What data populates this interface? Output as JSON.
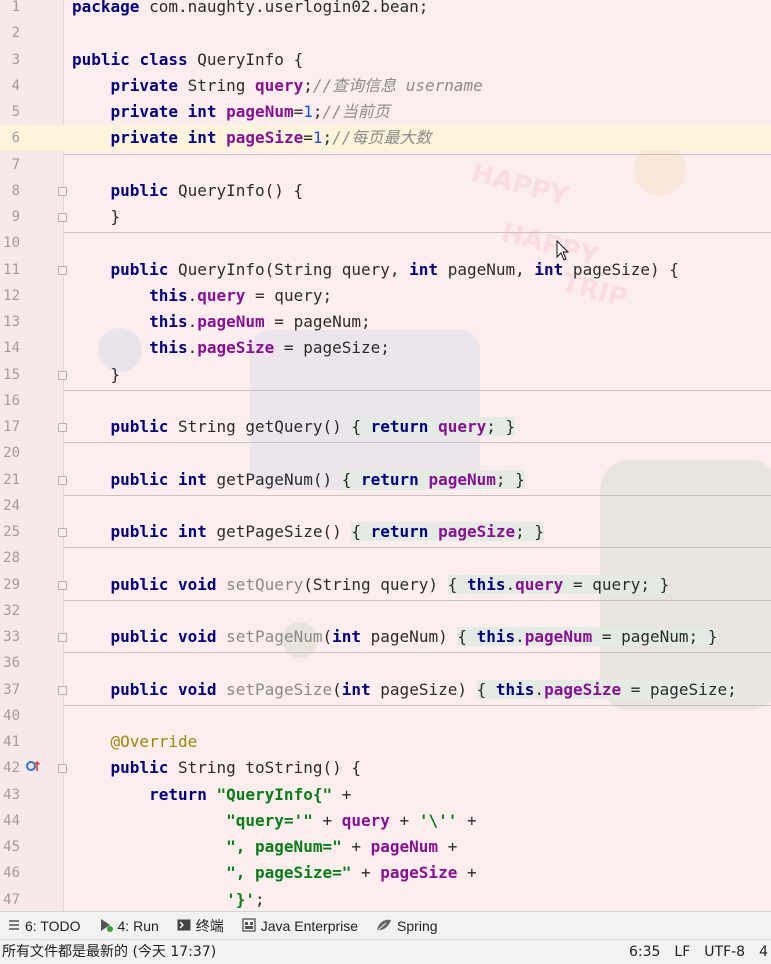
{
  "editor": {
    "lines": [
      {
        "n": "1",
        "tokens": [
          {
            "t": "package",
            "c": "kw"
          },
          {
            "t": " com.naughty.userlogin02.bean;"
          }
        ]
      },
      {
        "n": "2",
        "tokens": []
      },
      {
        "n": "3",
        "tokens": [
          {
            "t": "public",
            "c": "kw"
          },
          {
            "t": " "
          },
          {
            "t": "class",
            "c": "kw"
          },
          {
            "t": " QueryInfo {"
          }
        ]
      },
      {
        "n": "4",
        "tokens": [
          {
            "t": "    "
          },
          {
            "t": "private",
            "c": "kw"
          },
          {
            "t": " String "
          },
          {
            "t": "query",
            "c": "field"
          },
          {
            "t": ";"
          },
          {
            "t": "//查询信息 username",
            "c": "cmt"
          }
        ]
      },
      {
        "n": "5",
        "tokens": [
          {
            "t": "    "
          },
          {
            "t": "private",
            "c": "kw"
          },
          {
            "t": " "
          },
          {
            "t": "int",
            "c": "kw"
          },
          {
            "t": " "
          },
          {
            "t": "pageNum",
            "c": "field"
          },
          {
            "t": "="
          },
          {
            "t": "1",
            "c": "num"
          },
          {
            "t": ";"
          },
          {
            "t": "//当前页",
            "c": "cmt"
          }
        ]
      },
      {
        "n": "6",
        "current": true,
        "tokens": [
          {
            "t": "    "
          },
          {
            "t": "private",
            "c": "kw"
          },
          {
            "t": " "
          },
          {
            "t": "int",
            "c": "kw"
          },
          {
            "t": " "
          },
          {
            "t": "pageSize",
            "c": "field"
          },
          {
            "t": "="
          },
          {
            "t": "1",
            "c": "num"
          },
          {
            "t": ";"
          },
          {
            "t": "//每页最大数",
            "c": "cmt"
          }
        ]
      },
      {
        "n": "7",
        "tokens": [],
        "sep": true
      },
      {
        "n": "8",
        "fold": true,
        "tokens": [
          {
            "t": "    "
          },
          {
            "t": "public",
            "c": "kw"
          },
          {
            "t": " QueryInfo() {"
          }
        ]
      },
      {
        "n": "9",
        "fold": true,
        "tokens": [
          {
            "t": "    }"
          }
        ]
      },
      {
        "n": "10",
        "tokens": [],
        "sep": true
      },
      {
        "n": "11",
        "fold": true,
        "tokens": [
          {
            "t": "    "
          },
          {
            "t": "public",
            "c": "kw"
          },
          {
            "t": " QueryInfo(String query, "
          },
          {
            "t": "int",
            "c": "kw"
          },
          {
            "t": " pageNum, "
          },
          {
            "t": "int",
            "c": "kw"
          },
          {
            "t": " pageSize) {"
          }
        ]
      },
      {
        "n": "12",
        "tokens": [
          {
            "t": "        "
          },
          {
            "t": "this",
            "c": "kw"
          },
          {
            "t": "."
          },
          {
            "t": "query",
            "c": "field"
          },
          {
            "t": " = query;"
          }
        ]
      },
      {
        "n": "13",
        "tokens": [
          {
            "t": "        "
          },
          {
            "t": "this",
            "c": "kw"
          },
          {
            "t": "."
          },
          {
            "t": "pageNum",
            "c": "field"
          },
          {
            "t": " = pageNum;"
          }
        ]
      },
      {
        "n": "14",
        "tokens": [
          {
            "t": "        "
          },
          {
            "t": "this",
            "c": "kw"
          },
          {
            "t": "."
          },
          {
            "t": "pageSize",
            "c": "field"
          },
          {
            "t": " = pageSize;"
          }
        ]
      },
      {
        "n": "15",
        "fold": true,
        "tokens": [
          {
            "t": "    }"
          }
        ]
      },
      {
        "n": "16",
        "tokens": [],
        "sep": true
      },
      {
        "n": "17",
        "fold": true,
        "tokens": [
          {
            "t": "    "
          },
          {
            "t": "public",
            "c": "kw"
          },
          {
            "t": " String getQuery() "
          },
          {
            "t": "{ ",
            "c": "fold"
          },
          {
            "t": "return",
            "c": "kw fold"
          },
          {
            "t": " ",
            "c": "fold"
          },
          {
            "t": "query",
            "c": "field fold"
          },
          {
            "t": "; }",
            "c": "fold"
          }
        ]
      },
      {
        "n": "20",
        "tokens": [],
        "sep": true
      },
      {
        "n": "21",
        "fold": true,
        "tokens": [
          {
            "t": "    "
          },
          {
            "t": "public",
            "c": "kw"
          },
          {
            "t": " "
          },
          {
            "t": "int",
            "c": "kw"
          },
          {
            "t": " getPageNum() "
          },
          {
            "t": "{ ",
            "c": "fold"
          },
          {
            "t": "return",
            "c": "kw fold"
          },
          {
            "t": " ",
            "c": "fold"
          },
          {
            "t": "pageNum",
            "c": "field fold"
          },
          {
            "t": "; }",
            "c": "fold"
          }
        ]
      },
      {
        "n": "24",
        "tokens": [],
        "sep": true
      },
      {
        "n": "25",
        "fold": true,
        "tokens": [
          {
            "t": "    "
          },
          {
            "t": "public",
            "c": "kw"
          },
          {
            "t": " "
          },
          {
            "t": "int",
            "c": "kw"
          },
          {
            "t": " getPageSize() "
          },
          {
            "t": "{ ",
            "c": "fold"
          },
          {
            "t": "return",
            "c": "kw fold"
          },
          {
            "t": " ",
            "c": "fold"
          },
          {
            "t": "pageSize",
            "c": "field fold"
          },
          {
            "t": "; }",
            "c": "fold"
          }
        ]
      },
      {
        "n": "28",
        "tokens": [],
        "sep": true
      },
      {
        "n": "29",
        "fold": true,
        "tokens": [
          {
            "t": "    "
          },
          {
            "t": "public",
            "c": "kw"
          },
          {
            "t": " "
          },
          {
            "t": "void",
            "c": "kw"
          },
          {
            "t": " "
          },
          {
            "t": "setQuery",
            "c": "gray"
          },
          {
            "t": "(String query) "
          },
          {
            "t": "{ ",
            "c": "fold"
          },
          {
            "t": "this",
            "c": "kw fold"
          },
          {
            "t": ".",
            "c": "fold"
          },
          {
            "t": "query",
            "c": "field fold"
          },
          {
            "t": " = query; }",
            "c": "fold"
          }
        ]
      },
      {
        "n": "32",
        "tokens": [],
        "sep": true
      },
      {
        "n": "33",
        "fold": true,
        "tokens": [
          {
            "t": "    "
          },
          {
            "t": "public",
            "c": "kw"
          },
          {
            "t": " "
          },
          {
            "t": "void",
            "c": "kw"
          },
          {
            "t": " "
          },
          {
            "t": "setPageNum",
            "c": "gray"
          },
          {
            "t": "("
          },
          {
            "t": "int",
            "c": "kw"
          },
          {
            "t": " pageNum) "
          },
          {
            "t": "{ ",
            "c": "fold"
          },
          {
            "t": "this",
            "c": "kw fold"
          },
          {
            "t": ".",
            "c": "fold"
          },
          {
            "t": "pageNum",
            "c": "field fold"
          },
          {
            "t": " = pageNum; }",
            "c": "fold"
          }
        ]
      },
      {
        "n": "36",
        "tokens": [],
        "sep": true
      },
      {
        "n": "37",
        "fold": true,
        "tokens": [
          {
            "t": "    "
          },
          {
            "t": "public",
            "c": "kw"
          },
          {
            "t": " "
          },
          {
            "t": "void",
            "c": "kw"
          },
          {
            "t": " "
          },
          {
            "t": "setPageSize",
            "c": "gray"
          },
          {
            "t": "("
          },
          {
            "t": "int",
            "c": "kw"
          },
          {
            "t": " pageSize) "
          },
          {
            "t": "{ ",
            "c": "fold"
          },
          {
            "t": "this",
            "c": "kw fold"
          },
          {
            "t": ".",
            "c": "fold"
          },
          {
            "t": "pageSize",
            "c": "field fold"
          },
          {
            "t": " = pageSize;",
            "c": "fold"
          }
        ]
      },
      {
        "n": "40",
        "tokens": [],
        "sep": true
      },
      {
        "n": "41",
        "tokens": [
          {
            "t": "    "
          },
          {
            "t": "@Override",
            "c": "ann"
          }
        ]
      },
      {
        "n": "42",
        "fold": true,
        "gutter_icon": "override-icon",
        "tokens": [
          {
            "t": "    "
          },
          {
            "t": "public",
            "c": "kw"
          },
          {
            "t": " String toString() {"
          }
        ]
      },
      {
        "n": "43",
        "tokens": [
          {
            "t": "        "
          },
          {
            "t": "return",
            "c": "kw"
          },
          {
            "t": " "
          },
          {
            "t": "\"QueryInfo{\"",
            "c": "str"
          },
          {
            "t": " +"
          }
        ]
      },
      {
        "n": "44",
        "tokens": [
          {
            "t": "                "
          },
          {
            "t": "\"query='\"",
            "c": "str"
          },
          {
            "t": " + "
          },
          {
            "t": "query",
            "c": "field"
          },
          {
            "t": " + "
          },
          {
            "t": "'\\''",
            "c": "str"
          },
          {
            "t": " +"
          }
        ]
      },
      {
        "n": "45",
        "tokens": [
          {
            "t": "                "
          },
          {
            "t": "\", pageNum=\"",
            "c": "str"
          },
          {
            "t": " + "
          },
          {
            "t": "pageNum",
            "c": "field"
          },
          {
            "t": " +"
          }
        ]
      },
      {
        "n": "46",
        "tokens": [
          {
            "t": "                "
          },
          {
            "t": "\", pageSize=\"",
            "c": "str"
          },
          {
            "t": " + "
          },
          {
            "t": "pageSize",
            "c": "field"
          },
          {
            "t": " +"
          }
        ]
      },
      {
        "n": "47",
        "tokens": [
          {
            "t": "                "
          },
          {
            "t": "'}'",
            "c": "str"
          },
          {
            "t": ";"
          }
        ]
      }
    ]
  },
  "toolbar": {
    "items": [
      {
        "name": "todo",
        "icon": "list-icon",
        "label": "6: TODO"
      },
      {
        "name": "run",
        "icon": "run-icon",
        "label": "4: Run"
      },
      {
        "name": "terminal",
        "icon": "terminal-icon",
        "label": "终端"
      },
      {
        "name": "java-enterprise",
        "icon": "java-enterprise-icon",
        "label": "Java Enterprise"
      },
      {
        "name": "spring",
        "icon": "spring-leaf-icon",
        "label": "Spring"
      }
    ]
  },
  "status": {
    "message": "所有文件都是最新的 (今天 17:37)",
    "position": "6:35",
    "line_separator": "LF",
    "encoding": "UTF-8",
    "indent": "4"
  },
  "colors": {
    "keyword": "#000080",
    "field": "#871094",
    "string": "#067d17",
    "number": "#1750eb",
    "comment": "#8c8c8c",
    "annotation": "#9e880d",
    "current_line": "#fcf5dc"
  }
}
